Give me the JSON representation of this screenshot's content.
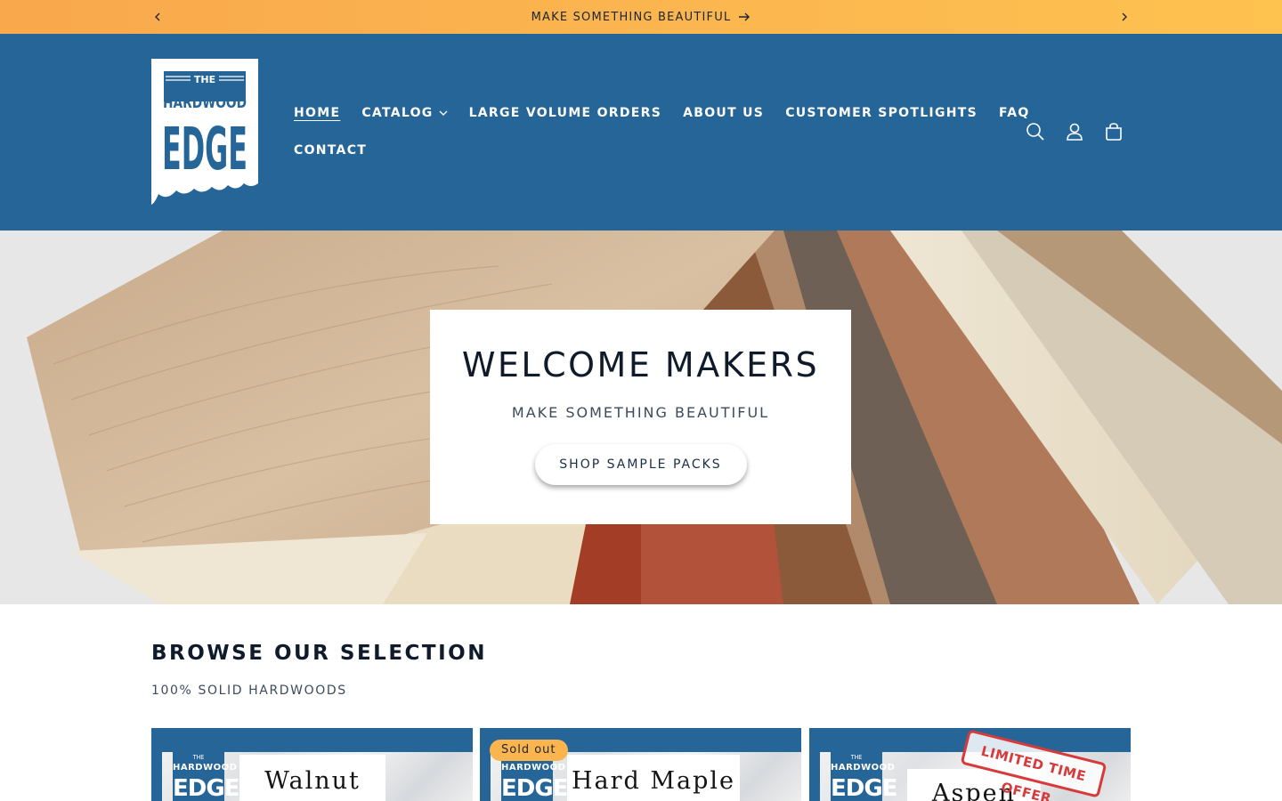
{
  "announcement": {
    "text": "MAKE SOMETHING BEAUTIFUL"
  },
  "header": {
    "logo": {
      "line1": "THE",
      "line2": "HARDWOOD",
      "line3": "EDGE"
    },
    "nav": [
      {
        "label": "HOME",
        "active": true
      },
      {
        "label": "CATALOG",
        "has_dropdown": true
      },
      {
        "label": "LARGE VOLUME ORDERS"
      },
      {
        "label": "ABOUT US"
      },
      {
        "label": "CUSTOMER SPOTLIGHTS"
      },
      {
        "label": "FAQ"
      },
      {
        "label": "CONTACT"
      }
    ],
    "icons": [
      "search-icon",
      "account-icon",
      "cart-icon"
    ]
  },
  "hero": {
    "title": "WELCOME MAKERS",
    "subtitle": "MAKE SOMETHING BEAUTIFUL",
    "button": "SHOP SAMPLE PACKS"
  },
  "browse": {
    "title": "BROWSE OUR SELECTION",
    "subtitle": "100% SOLID HARDWOODS",
    "cards": [
      {
        "label": "Walnut",
        "badge": "",
        "logo_text": "THE HARDWOOD EDGE"
      },
      {
        "label": "Hard Maple",
        "badge": "Sold out",
        "logo_text": "THE HARDWOOD EDGE"
      },
      {
        "label": "Aspen",
        "badge": "",
        "stamp": "LIMITED TIME OFFER",
        "logo_text": "THE HARDWOOD EDGE"
      }
    ]
  },
  "colors": {
    "header_bg": "#266598",
    "announcement_gradient": [
      "#f9a84c",
      "#fec24f"
    ],
    "badge": "#fbb54f",
    "stamp": "#d73a3a"
  }
}
